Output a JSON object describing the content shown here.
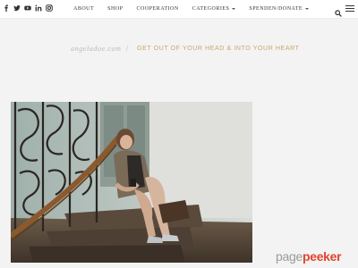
{
  "header": {
    "social_icons": [
      "facebook-icon",
      "twitter-icon",
      "youtube-icon",
      "linkedin-icon",
      "instagram-icon"
    ],
    "nav": [
      {
        "label": "ABOUT",
        "has_dropdown": false
      },
      {
        "label": "SHOP",
        "has_dropdown": false
      },
      {
        "label": "COOPERATION",
        "has_dropdown": false
      },
      {
        "label": "CATEGORIES",
        "has_dropdown": true
      },
      {
        "label": "SPENDEN/DONATE",
        "has_dropdown": true
      }
    ],
    "right_icons": [
      "search-icon",
      "menu-icon"
    ]
  },
  "tagline": {
    "site_name": "angeladoe.com",
    "separator": "/",
    "motto": "GET OUT OF YOUR HEAD & INTO YOUR HEART"
  },
  "featured_image": {
    "alt": "Woman sitting on a staircase next to a wrought iron railing"
  },
  "watermark": {
    "part1": "page",
    "part2": "peeker"
  },
  "colors": {
    "accent": "#c8a66a",
    "site_name": "#b9b9b9",
    "page_background": "#f3f3f3",
    "watermark_gray": "#9a9a9a",
    "watermark_red": "#e2442f"
  }
}
